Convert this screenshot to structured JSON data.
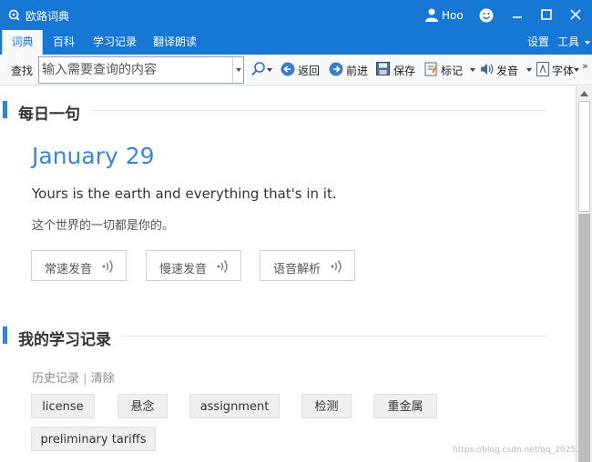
{
  "window": {
    "title": "欧路词典",
    "user_name": "Hoo",
    "brand_color": "#1777d4",
    "accent_color": "#2d87d7"
  },
  "nav": {
    "tabs": [
      {
        "label": "词典",
        "active": true
      },
      {
        "label": "百科",
        "active": false
      },
      {
        "label": "学习记录",
        "active": false
      },
      {
        "label": "翻译朗读",
        "active": false
      }
    ],
    "settings_label": "设置",
    "tools_label": "工具"
  },
  "toolbar": {
    "search_label": "查找",
    "search_placeholder": "输入需要查询的内容",
    "back_label": "返回",
    "forward_label": "前进",
    "save_label": "保存",
    "mark_label": "标记",
    "pronounce_label": "发音",
    "font_label": "字体",
    "more_label": "»"
  },
  "daily": {
    "section_title": "每日一句",
    "date": "January 29",
    "sentence_en": "Yours is the earth and everything that's in it.",
    "sentence_zh": "这个世界的一切都是你的。",
    "buttons": [
      "常速发音",
      "慢速发音",
      "语音解析"
    ]
  },
  "records": {
    "section_title": "我的学习记录",
    "history_label": "历史记录",
    "separator": "|",
    "clear_label": "清除",
    "words": [
      "license",
      "悬念",
      "assignment",
      "检测",
      "重金属",
      "preliminary tariffs"
    ]
  },
  "watermark": "https://blog.csdn.net/qq_2025..."
}
